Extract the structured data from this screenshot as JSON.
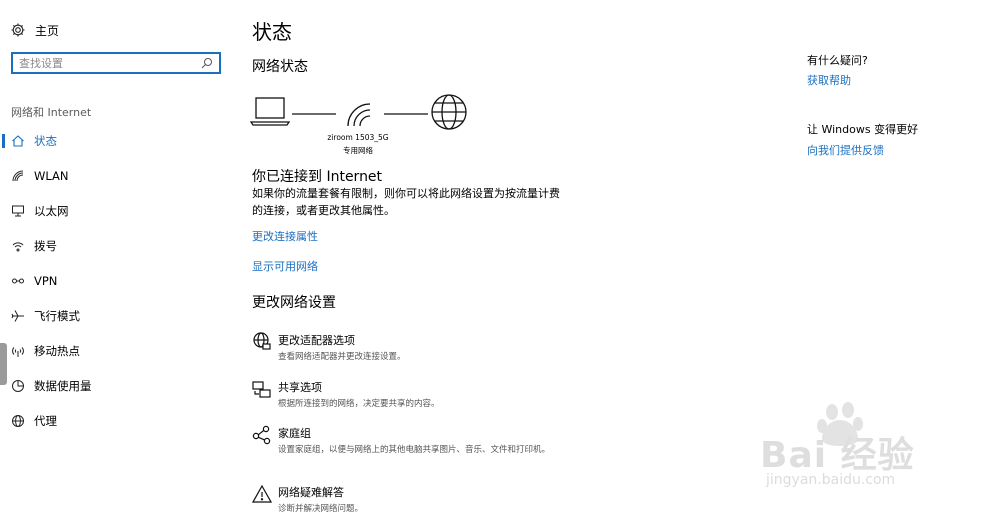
{
  "sidebar": {
    "home_label": "主页",
    "search_placeholder": "查找设置",
    "section_label": "网络和 Internet",
    "items": [
      {
        "label": "状态",
        "icon": "home-status-icon",
        "active": true
      },
      {
        "label": "WLAN",
        "icon": "wifi-icon"
      },
      {
        "label": "以太网",
        "icon": "ethernet-icon"
      },
      {
        "label": "拨号",
        "icon": "dialup-icon"
      },
      {
        "label": "VPN",
        "icon": "vpn-icon"
      },
      {
        "label": "飞行模式",
        "icon": "airplane-icon"
      },
      {
        "label": "移动热点",
        "icon": "hotspot-icon"
      },
      {
        "label": "数据使用量",
        "icon": "data-usage-icon"
      },
      {
        "label": "代理",
        "icon": "proxy-globe-icon"
      }
    ]
  },
  "main": {
    "title": "状态",
    "network_status_heading": "网络状态",
    "network_name": "ziroom 1503_5G",
    "network_type": "专用网络",
    "connected_heading": "你已连接到 Internet",
    "connected_desc": "如果你的流量套餐有限制，则你可以将此网络设置为按流量计费的连接，或者更改其他属性。",
    "change_props_link": "更改连接属性",
    "show_networks_link": "显示可用网络",
    "change_settings_heading": "更改网络设置",
    "options": [
      {
        "title": "更改适配器选项",
        "desc": "查看网络适配器并更改连接设置。",
        "icon": "adapter-globe-icon"
      },
      {
        "title": "共享选项",
        "desc": "根据所连接到的网络，决定要共享的内容。",
        "icon": "sharing-icon"
      },
      {
        "title": "家庭组",
        "desc": "设置家庭组，以便与网络上的其他电脑共享图片、音乐、文件和打印机。",
        "icon": "homegroup-icon"
      },
      {
        "title": "网络疑难解答",
        "desc": "诊断并解决网络问题。",
        "icon": "warning-icon"
      }
    ]
  },
  "right": {
    "question_heading": "有什么疑问?",
    "help_link": "获取帮助",
    "improve_heading": "让 Windows 变得更好",
    "feedback_link": "向我们提供反馈"
  },
  "watermark": {
    "brand": "Bai 经验",
    "url": "jingyan.baidu.com"
  },
  "colors": {
    "accent": "#1a6fc0"
  }
}
